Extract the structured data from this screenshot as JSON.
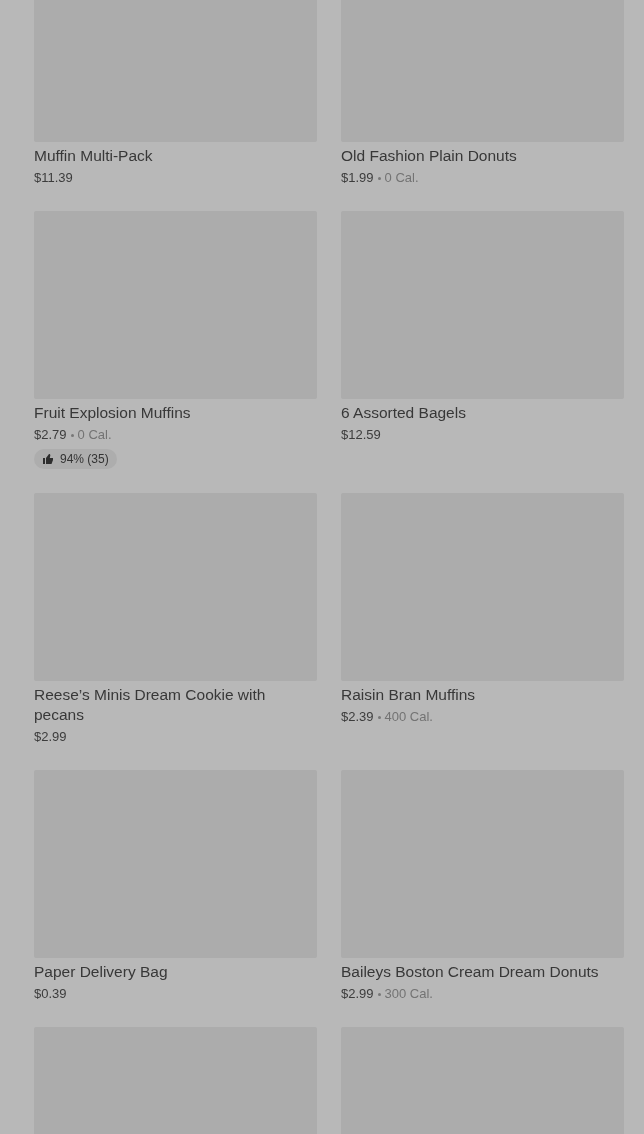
{
  "products": [
    {
      "kind": "product",
      "name": "Muffin Multi-Pack",
      "price": "$11.39"
    },
    {
      "kind": "product",
      "name": "Old Fashion Plain Donuts",
      "price": "$1.99",
      "calories": "0 Cal."
    },
    {
      "kind": "product",
      "name": "Fruit Explosion Muffins",
      "price": "$2.79",
      "calories": "0 Cal.",
      "rating": "94% (35)"
    },
    {
      "kind": "product",
      "name": "6 Assorted Bagels",
      "price": "$12.59"
    },
    {
      "kind": "product",
      "name": "Reese’s Minis Dream Cookie with pecans",
      "price": "$2.99"
    },
    {
      "kind": "product",
      "name": "Raisin Bran Muffins",
      "price": "$2.39",
      "calories": "400 Cal."
    },
    {
      "kind": "product",
      "name": "Paper Delivery Bag",
      "price": "$0.39"
    },
    {
      "kind": "product",
      "name": "Baileys Boston Cream Dream Donuts",
      "price": "$2.99",
      "calories": "300 Cal."
    },
    {
      "kind": "image-only"
    },
    {
      "kind": "image-only"
    }
  ]
}
